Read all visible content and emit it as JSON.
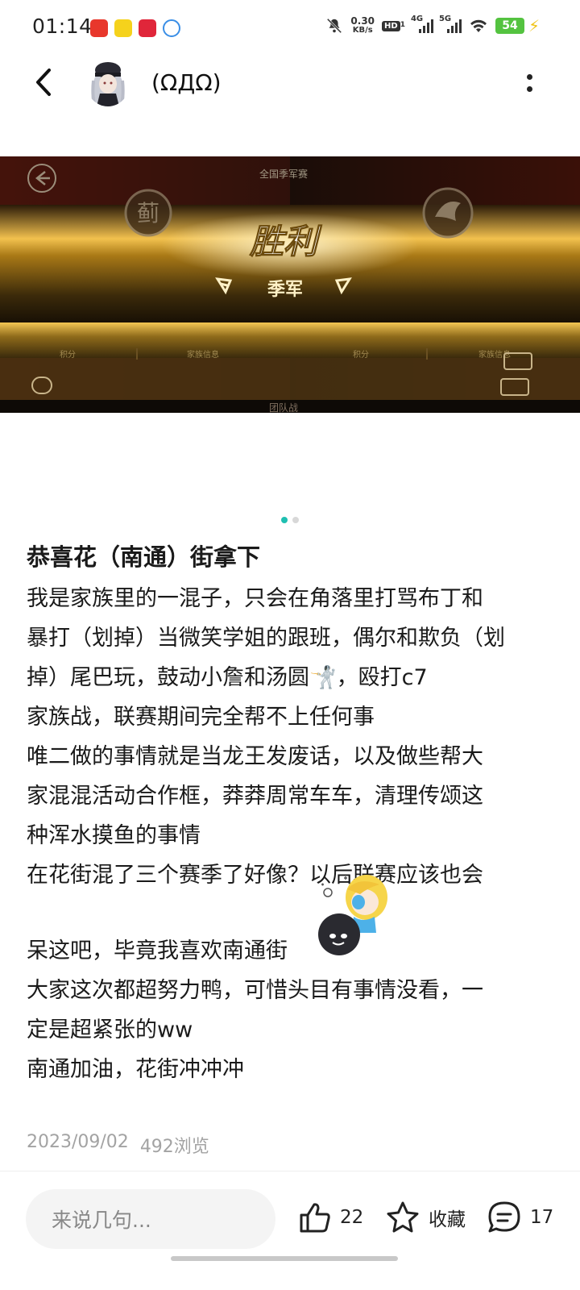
{
  "status_bar": {
    "time": "01:14",
    "net_speed_value": "0.30",
    "net_speed_unit": "KB/s",
    "hd_label": "HD",
    "hd_sub": "1",
    "sig1_label": "4G",
    "sig2_label": "5G",
    "battery": "54"
  },
  "header": {
    "username": "(ΩДΩ)"
  },
  "post_image": {
    "top_label": "全国季军赛",
    "victory_text": "胜利",
    "rank_text": "季军",
    "left_badge_char": "蓟",
    "footer_left1": "积分",
    "footer_left2": "家族信息",
    "footer_right1": "积分",
    "footer_right2": "家族信息",
    "bottom_label": "团队战"
  },
  "post": {
    "title": "恭喜花（南通）街拿下",
    "lines": [
      "我是家族里的一混子，只会在角落里打骂布丁和",
      "暴打（划掉）当微笑学姐的跟班，偶尔和欺负（划",
      "掉）尾巴玩，鼓动小詹和汤圆🤺，殴打c7",
      "家族战，联赛期间完全帮不上任何事",
      "唯二做的事情就是当龙王发废话，以及做些帮大",
      "家混混活动合作框，莽莽周常车车，清理传颂这",
      "种浑水摸鱼的事情",
      "在花街混了三个赛季了好像？以后联赛应该也会",
      "呆这吧，毕竟我喜欢南通街",
      "大家这次都超努力鸭，可惜头目有事情没看，一",
      "定是超紧张的ww",
      "南通加油，花街冲冲冲"
    ],
    "date": "2023/09/02",
    "views": "492浏览"
  },
  "bottom_bar": {
    "comment_placeholder": "来说几句...",
    "like_count": "22",
    "favorite_label": "收藏",
    "comment_count": "17"
  },
  "colors": {
    "accent_dot": "#1fbfb1",
    "meta_gray": "#a3a3a3",
    "battery_green": "#54c340"
  }
}
